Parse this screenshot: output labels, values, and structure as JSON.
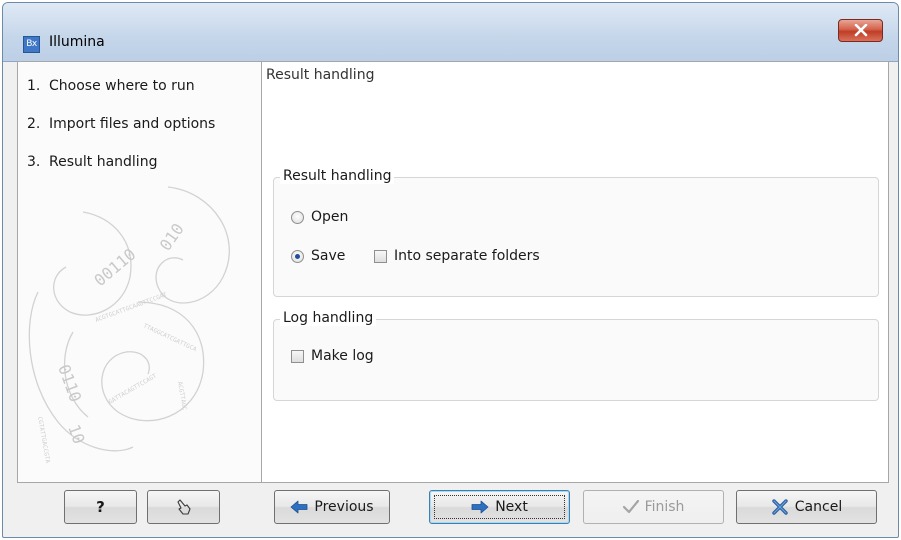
{
  "window": {
    "title": "Illumina",
    "app_icon_text": "Bx",
    "close_icon": "close-x-icon"
  },
  "steps": [
    {
      "num": "1.",
      "label": "Choose where to run"
    },
    {
      "num": "2.",
      "label": "Import files and options"
    },
    {
      "num": "3.",
      "label": "Result handling"
    }
  ],
  "main": {
    "heading": "Result handling",
    "result_group": {
      "title": "Result handling",
      "open_label": "Open",
      "save_label": "Save",
      "separate_folders_label": "Into separate folders",
      "selected": "Save"
    },
    "log_group": {
      "title": "Log handling",
      "make_log_label": "Make log",
      "make_log_checked": false
    }
  },
  "buttons": {
    "help": "?",
    "previous": "Previous",
    "next": "Next",
    "finish": "Finish",
    "cancel": "Cancel"
  },
  "colors": {
    "arrow_blue": "#2f6fc0",
    "close_red": "#c9452e",
    "finish_disabled": "#9a9a9a"
  }
}
